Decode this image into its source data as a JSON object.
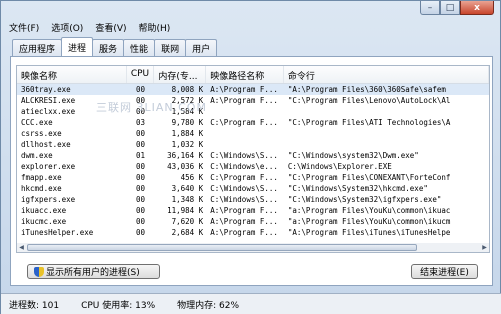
{
  "menu": [
    {
      "label": "文件(F)"
    },
    {
      "label": "选项(O)"
    },
    {
      "label": "查看(V)"
    },
    {
      "label": "帮助(H)"
    }
  ],
  "window_controls": {
    "minimize": "–",
    "maximize": "□",
    "close": "x"
  },
  "tabs": [
    {
      "label": "应用程序"
    },
    {
      "label": "进程"
    },
    {
      "label": "服务"
    },
    {
      "label": "性能"
    },
    {
      "label": "联网"
    },
    {
      "label": "用户"
    }
  ],
  "active_tab": "进程",
  "columns": [
    "映像名称",
    "CPU",
    "内存(专...",
    "映像路径名称",
    "命令行"
  ],
  "rows": [
    [
      "360tray.exe",
      "00",
      "8,008 K",
      "A:\\Program F...",
      "\"A:\\Program Files\\360\\360Safe\\safem"
    ],
    [
      "ALCKRESI.exe",
      "00",
      "2,572 K",
      "A:\\Program F...",
      "\"C:\\Program Files\\Lenovo\\AutoLock\\Al"
    ],
    [
      "atieclxx.exe",
      "00",
      "1,584 K",
      "",
      ""
    ],
    [
      "CCC.exe",
      "03",
      "9,780 K",
      "C:\\Program F...",
      "\"C:\\Program Files\\ATI Technologies\\A"
    ],
    [
      "csrss.exe",
      "00",
      "1,884 K",
      "",
      ""
    ],
    [
      "dllhost.exe",
      "00",
      "1,032 K",
      "",
      ""
    ],
    [
      "dwm.exe",
      "01",
      "36,164 K",
      "C:\\Windows\\S...",
      "\"C:\\Windows\\system32\\Dwm.exe\""
    ],
    [
      "explorer.exe",
      "00",
      "43,036 K",
      "C:\\Windows\\e...",
      "C:\\Windows\\Explorer.EXE"
    ],
    [
      "fmapp.exe",
      "00",
      "456 K",
      "C:\\Program F...",
      "\"C:\\Program Files\\CONEXANT\\ForteConf"
    ],
    [
      "hkcmd.exe",
      "00",
      "3,640 K",
      "C:\\Windows\\S...",
      "\"C:\\Windows\\System32\\hkcmd.exe\""
    ],
    [
      "igfxpers.exe",
      "00",
      "1,348 K",
      "C:\\Windows\\S...",
      "\"C:\\Windows\\System32\\igfxpers.exe\""
    ],
    [
      "ikuacc.exe",
      "00",
      "11,984 K",
      "A:\\Program F...",
      "\"a:\\Program Files\\YouKu\\common\\ikuac"
    ],
    [
      "ikucmc.exe",
      "00",
      "7,620 K",
      "A:\\Program F...",
      "\"a:\\Program Files\\YouKu\\common\\ikucm"
    ],
    [
      "iTunesHelper.exe",
      "00",
      "2,684 K",
      "A:\\Program F...",
      "\"A:\\Program Files\\iTunes\\iTunesHelpe"
    ]
  ],
  "watermark": "三联网 3LIAN.COM",
  "buttons": {
    "show_all": "显示所有用户的进程(S)",
    "end_process": "结束进程(E)"
  },
  "status": {
    "processes": "进程数: 101",
    "cpu": "CPU 使用率: 13%",
    "memory": "物理内存: 62%"
  }
}
